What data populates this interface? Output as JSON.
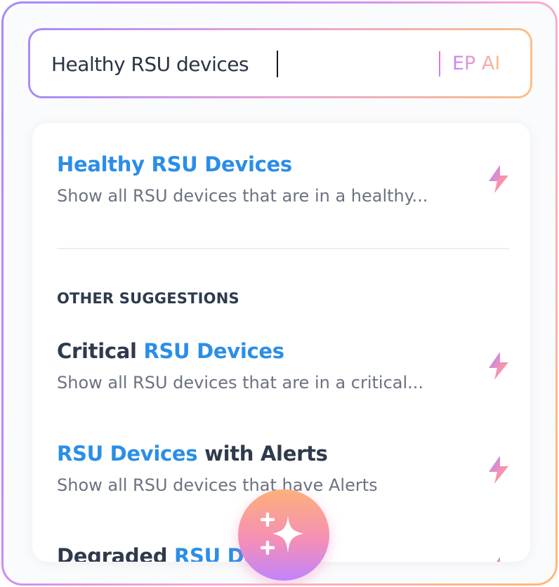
{
  "search": {
    "value": "Healthy RSU devices",
    "ai_label": "EP AI"
  },
  "top_result": {
    "title_parts": [
      {
        "text": "Healthy RSU Devices",
        "highlight": true
      }
    ],
    "description": "Show all RSU devices that are in a healthy..."
  },
  "section_label": "OTHER SUGGESTIONS",
  "suggestions": [
    {
      "title_parts": [
        {
          "text": "Critical ",
          "highlight": false
        },
        {
          "text": "RSU Devices",
          "highlight": true
        }
      ],
      "description": "Show all RSU devices that are in a critical..."
    },
    {
      "title_parts": [
        {
          "text": "RSU Devices",
          "highlight": true
        },
        {
          "text": " with Alerts",
          "highlight": false
        }
      ],
      "description": "Show all RSU devices that have Alerts"
    },
    {
      "title_parts": [
        {
          "text": "Degraded ",
          "highlight": false
        },
        {
          "text": "RSU Devices",
          "highlight": true
        }
      ],
      "description": ""
    }
  ],
  "icons": {
    "suggestion_icon": "lightning-bolt-icon",
    "fab_icon": "sparkle-icon"
  },
  "colors": {
    "highlight": "#2b8ee8",
    "dark_text": "#2f3a4d",
    "muted_text": "#6b7280",
    "gradient_purple": "#a78bfa",
    "gradient_pink": "#f9a8d4",
    "gradient_orange": "#fdba74"
  }
}
